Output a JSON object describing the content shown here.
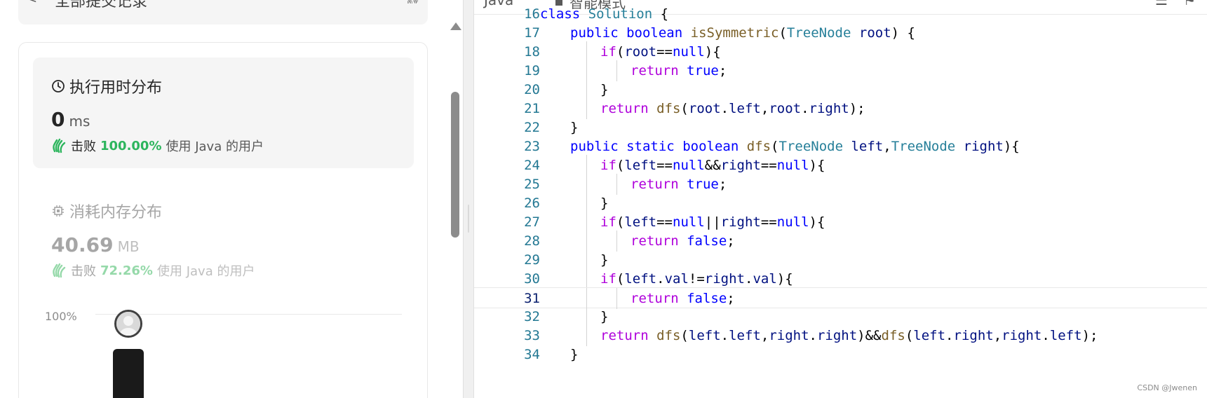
{
  "left_panel": {
    "top_title": "全部提交记录",
    "runtime": {
      "title": "执行用时分布",
      "value": "0",
      "unit": "ms",
      "beats_word": "击败",
      "beats_pct": "100.00%",
      "beats_desc": "使用 Java 的用户"
    },
    "memory": {
      "title": "消耗内存分布",
      "value": "40.69",
      "unit": "MB",
      "beats_word": "击败",
      "beats_pct": "72.26%",
      "beats_desc": "使用 Java 的用户"
    },
    "chart": {
      "y_label": "100%"
    }
  },
  "editor": {
    "language": "Java",
    "mode": "智能模式",
    "active_line": 31,
    "lines": [
      {
        "n": "16",
        "indent": 0,
        "tokens": [
          [
            "kw",
            "class"
          ],
          [
            "pl",
            " "
          ],
          [
            "ty",
            "Solution"
          ],
          [
            "pl",
            " {"
          ]
        ]
      },
      {
        "n": "17",
        "indent": 1,
        "tokens": [
          [
            "kw",
            "public"
          ],
          [
            "pl",
            " "
          ],
          [
            "kw",
            "boolean"
          ],
          [
            "pl",
            " "
          ],
          [
            "fn",
            "isSymmetric"
          ],
          [
            "pl",
            "("
          ],
          [
            "ty",
            "TreeNode"
          ],
          [
            "pl",
            " "
          ],
          [
            "va",
            "root"
          ],
          [
            "pl",
            ") {"
          ]
        ]
      },
      {
        "n": "18",
        "indent": 2,
        "tokens": [
          [
            "kw2",
            "if"
          ],
          [
            "pl",
            "("
          ],
          [
            "va",
            "root"
          ],
          [
            "pl",
            "=="
          ],
          [
            "kw",
            "null"
          ],
          [
            "pl",
            "){"
          ]
        ]
      },
      {
        "n": "19",
        "indent": 3,
        "tokens": [
          [
            "kw2",
            "return"
          ],
          [
            "pl",
            " "
          ],
          [
            "kw",
            "true"
          ],
          [
            "pl",
            ";"
          ]
        ]
      },
      {
        "n": "20",
        "indent": 2,
        "tokens": [
          [
            "pl",
            "}"
          ]
        ]
      },
      {
        "n": "21",
        "indent": 2,
        "tokens": [
          [
            "kw2",
            "return"
          ],
          [
            "pl",
            " "
          ],
          [
            "fn",
            "dfs"
          ],
          [
            "pl",
            "("
          ],
          [
            "va",
            "root"
          ],
          [
            "pl",
            "."
          ],
          [
            "va",
            "left"
          ],
          [
            "pl",
            ","
          ],
          [
            "va",
            "root"
          ],
          [
            "pl",
            "."
          ],
          [
            "va",
            "right"
          ],
          [
            "pl",
            ");"
          ]
        ]
      },
      {
        "n": "22",
        "indent": 1,
        "tokens": [
          [
            "pl",
            "}"
          ]
        ]
      },
      {
        "n": "23",
        "indent": 1,
        "tokens": [
          [
            "kw",
            "public"
          ],
          [
            "pl",
            " "
          ],
          [
            "kw",
            "static"
          ],
          [
            "pl",
            " "
          ],
          [
            "kw",
            "boolean"
          ],
          [
            "pl",
            " "
          ],
          [
            "fn",
            "dfs"
          ],
          [
            "pl",
            "("
          ],
          [
            "ty",
            "TreeNode"
          ],
          [
            "pl",
            " "
          ],
          [
            "va",
            "left"
          ],
          [
            "pl",
            ","
          ],
          [
            "ty",
            "TreeNode"
          ],
          [
            "pl",
            " "
          ],
          [
            "va",
            "right"
          ],
          [
            "pl",
            "){"
          ]
        ]
      },
      {
        "n": "24",
        "indent": 2,
        "tokens": [
          [
            "kw2",
            "if"
          ],
          [
            "pl",
            "("
          ],
          [
            "va",
            "left"
          ],
          [
            "pl",
            "=="
          ],
          [
            "kw",
            "null"
          ],
          [
            "pl",
            "&&"
          ],
          [
            "va",
            "right"
          ],
          [
            "pl",
            "=="
          ],
          [
            "kw",
            "null"
          ],
          [
            "pl",
            "){"
          ]
        ]
      },
      {
        "n": "25",
        "indent": 3,
        "tokens": [
          [
            "kw2",
            "return"
          ],
          [
            "pl",
            " "
          ],
          [
            "kw",
            "true"
          ],
          [
            "pl",
            ";"
          ]
        ]
      },
      {
        "n": "26",
        "indent": 2,
        "tokens": [
          [
            "pl",
            "}"
          ]
        ]
      },
      {
        "n": "27",
        "indent": 2,
        "tokens": [
          [
            "kw2",
            "if"
          ],
          [
            "pl",
            "("
          ],
          [
            "va",
            "left"
          ],
          [
            "pl",
            "=="
          ],
          [
            "kw",
            "null"
          ],
          [
            "pl",
            "||"
          ],
          [
            "va",
            "right"
          ],
          [
            "pl",
            "=="
          ],
          [
            "kw",
            "null"
          ],
          [
            "pl",
            "){"
          ]
        ]
      },
      {
        "n": "28",
        "indent": 3,
        "tokens": [
          [
            "kw2",
            "return"
          ],
          [
            "pl",
            " "
          ],
          [
            "kw",
            "false"
          ],
          [
            "pl",
            ";"
          ]
        ]
      },
      {
        "n": "29",
        "indent": 2,
        "tokens": [
          [
            "pl",
            "}"
          ]
        ]
      },
      {
        "n": "30",
        "indent": 2,
        "tokens": [
          [
            "kw2",
            "if"
          ],
          [
            "pl",
            "("
          ],
          [
            "va",
            "left"
          ],
          [
            "pl",
            "."
          ],
          [
            "va",
            "val"
          ],
          [
            "pl",
            "!="
          ],
          [
            "va",
            "right"
          ],
          [
            "pl",
            "."
          ],
          [
            "va",
            "val"
          ],
          [
            "pl",
            "){"
          ]
        ]
      },
      {
        "n": "31",
        "indent": 3,
        "tokens": [
          [
            "kw2",
            "return"
          ],
          [
            "pl",
            " "
          ],
          [
            "kw",
            "false"
          ],
          [
            "pl",
            ";"
          ]
        ]
      },
      {
        "n": "32",
        "indent": 2,
        "tokens": [
          [
            "pl",
            "}"
          ]
        ]
      },
      {
        "n": "33",
        "indent": 2,
        "tokens": [
          [
            "kw2",
            "return"
          ],
          [
            "pl",
            " "
          ],
          [
            "fn",
            "dfs"
          ],
          [
            "pl",
            "("
          ],
          [
            "va",
            "left"
          ],
          [
            "pl",
            "."
          ],
          [
            "va",
            "left"
          ],
          [
            "pl",
            ","
          ],
          [
            "va",
            "right"
          ],
          [
            "pl",
            "."
          ],
          [
            "va",
            "right"
          ],
          [
            "pl",
            ")&&"
          ],
          [
            "fn",
            "dfs"
          ],
          [
            "pl",
            "("
          ],
          [
            "va",
            "left"
          ],
          [
            "pl",
            "."
          ],
          [
            "va",
            "right"
          ],
          [
            "pl",
            ","
          ],
          [
            "va",
            "right"
          ],
          [
            "pl",
            "."
          ],
          [
            "va",
            "left"
          ],
          [
            "pl",
            ");"
          ]
        ]
      },
      {
        "n": "34",
        "indent": 1,
        "tokens": [
          [
            "pl",
            "}"
          ]
        ]
      }
    ]
  },
  "watermark": "CSDN @Jwenen"
}
